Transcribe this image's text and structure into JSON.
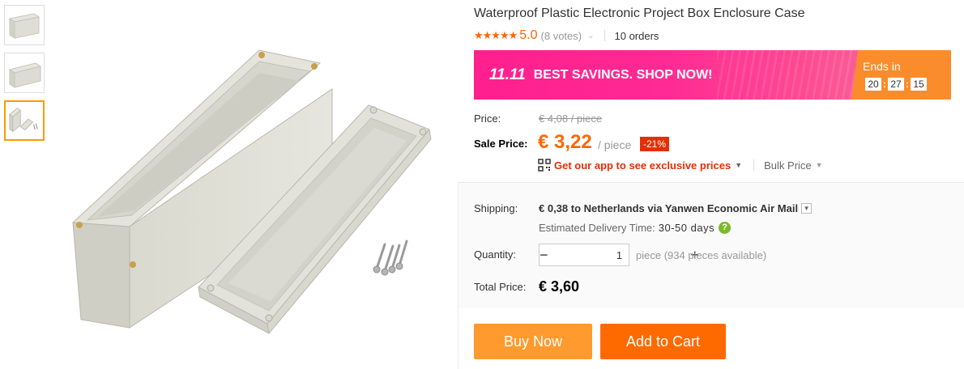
{
  "product": {
    "title": "Waterproof Plastic Electronic Project Box Enclosure Case",
    "stars": "★★★★★",
    "rating": "5.0",
    "votes": "(8 votes)",
    "orders": "10 orders"
  },
  "banner": {
    "logo": "11.11",
    "text": "BEST SAVINGS. SHOP NOW!",
    "ends_label": "Ends in",
    "countdown": {
      "hours": "20",
      "minutes": "27",
      "seconds": "15"
    }
  },
  "price": {
    "label": "Price:",
    "original": "€ 4,08 / piece",
    "sale_label": "Sale Price:",
    "sale": "€ 3,22",
    "unit": "/ piece",
    "discount": "-21%",
    "app_link": "Get our app to see exclusive prices",
    "bulk_price": "Bulk Price"
  },
  "shipping": {
    "label": "Shipping:",
    "value": "€ 0,38 to Netherlands via Yanwen Economic Air Mail",
    "delivery_label": "Estimated Delivery Time:",
    "delivery_days": "30-50 days",
    "help": "?"
  },
  "quantity": {
    "label": "Quantity:",
    "minus": "−",
    "value": "1",
    "plus": "+",
    "note": "piece (934 pieces available)"
  },
  "total": {
    "label": "Total Price:",
    "value": "€ 3,60"
  },
  "actions": {
    "buy_now": "Buy Now",
    "add_to_cart": "Add to Cart"
  },
  "colors": {
    "accent_orange": "#ff6a00",
    "buy_now_orange": "#ff9a2e",
    "sale_price": "#ff6600",
    "banner_pink": "#ff1f8e",
    "discount_red": "#e62e04"
  },
  "icons": {
    "qr": "qr-code-icon",
    "help": "help-icon",
    "dropdown": "chevron-down-icon"
  }
}
